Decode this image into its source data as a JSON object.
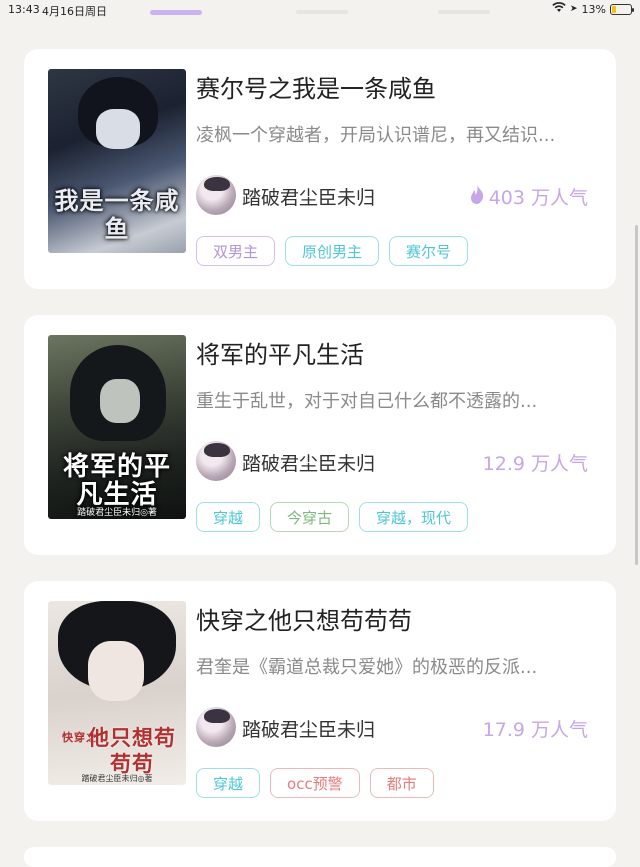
{
  "status": {
    "time": "13:43",
    "date": "4月16日周日",
    "battery": "13%",
    "battery_level": 0.13
  },
  "books": [
    {
      "title": "赛尔号之我是一条咸鱼",
      "cover_text": "我是一条咸鱼",
      "description": "凌枫一个穿越者，开局认识谱尼，再又结识...",
      "author": "踏破君尘臣未归",
      "popularity": "403 万人气",
      "tags": [
        "双男主",
        "原创男主",
        "赛尔号"
      ]
    },
    {
      "title": "将军的平凡生活",
      "cover_text": "将军的平凡生活",
      "cover_author": "踏破君尘臣未归◎著",
      "description": "重生于乱世，对于对自己什么都不透露的...",
      "author": "踏破君尘臣未归",
      "popularity": "12.9 万人气",
      "tags": [
        "穿越",
        "今穿古",
        "穿越，现代"
      ]
    },
    {
      "title": "快穿之他只想苟苟苟",
      "cover_text_small": "快穿之",
      "cover_text": "他只想苟苟苟",
      "cover_author": "踏破君尘臣未归◎著",
      "description": "君奎是《霸道总裁只爱她》的极恶的反派...",
      "author": "踏破君尘臣未归",
      "popularity": "17.9 万人气",
      "tags": [
        "穿越",
        "occ预警",
        "都市"
      ]
    }
  ],
  "colors": {
    "popularity": "#c7a6ea",
    "background": "#f3f2ef"
  }
}
